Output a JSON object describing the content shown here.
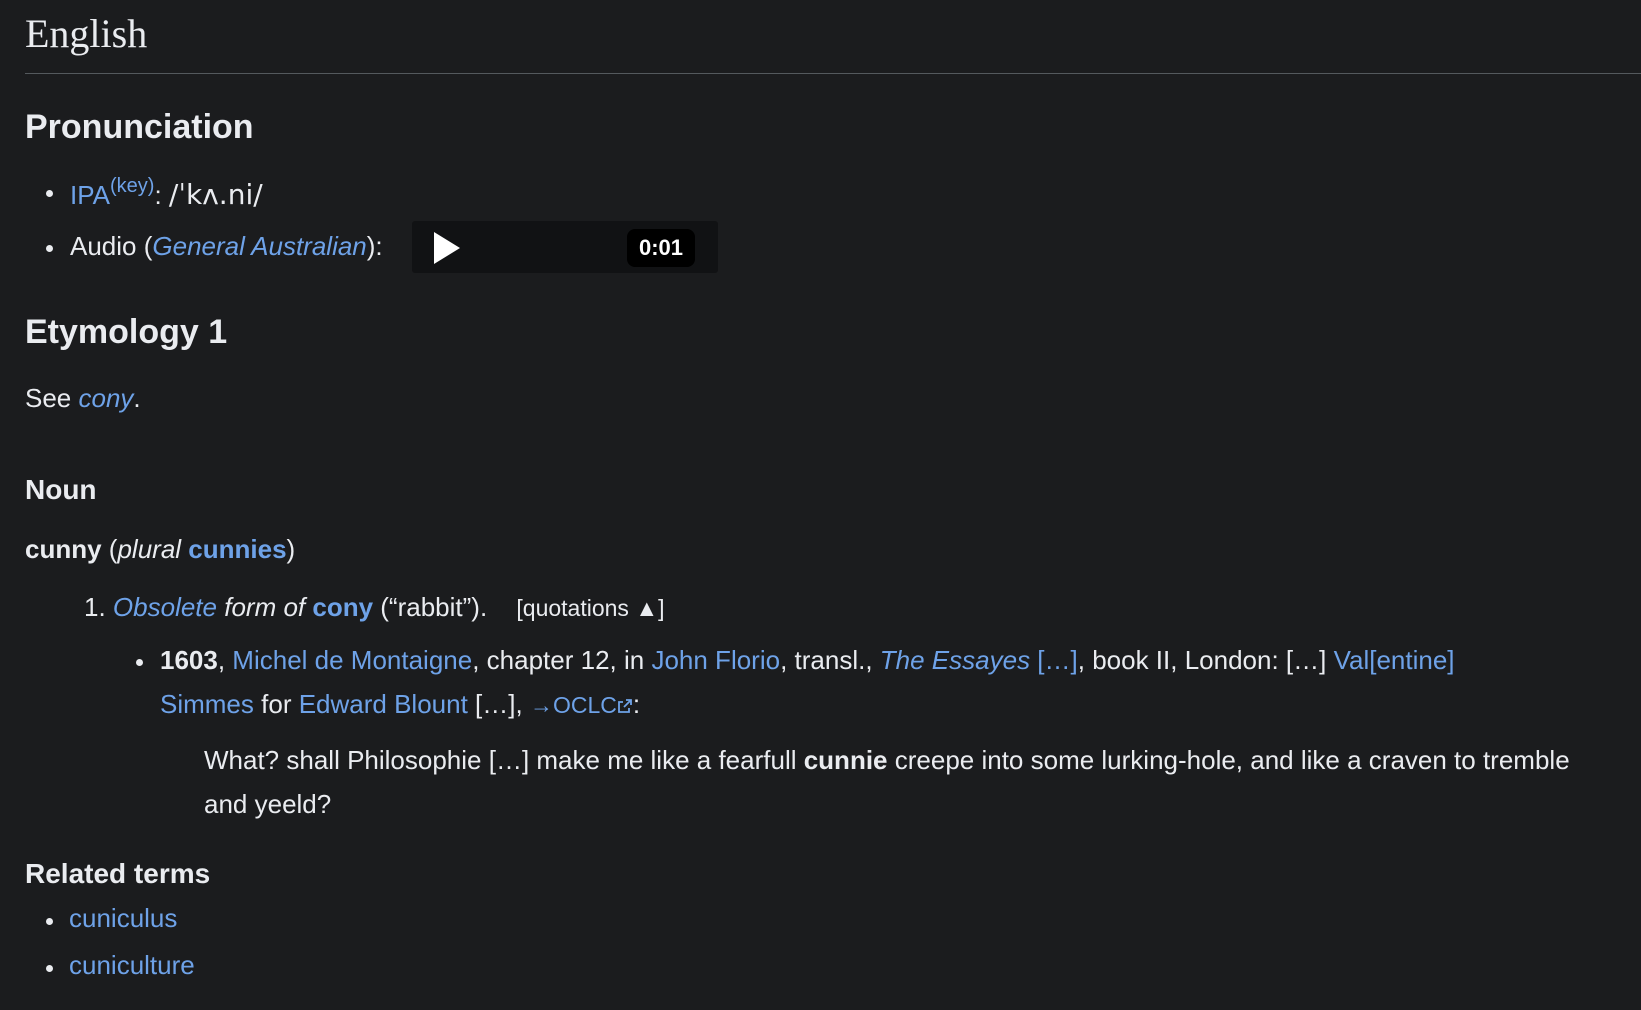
{
  "language": "English",
  "pronunciation": {
    "heading": "Pronunciation",
    "ipa": {
      "label": "IPA",
      "key": "(key)",
      "colon": ": ",
      "value": "/ˈkʌ.ni/"
    },
    "audio": {
      "label": "Audio (",
      "accent": "General Australian",
      "suffix": "):",
      "time": "0:01"
    }
  },
  "etymology": {
    "heading": "Etymology 1",
    "see": "See ",
    "see_link": "cony",
    "period": "."
  },
  "noun": {
    "heading": "Noun",
    "headword": "cunny",
    "open_paren": " (",
    "plural_label": "plural",
    "plural_space": " ",
    "plural_form": "cunnies",
    "close_paren": ")"
  },
  "sense": {
    "number": "1.",
    "obsolete": "Obsolete",
    "form_of": " form of ",
    "lemma": "cony",
    "gloss": " (“rabbit”).",
    "quotations_toggle": "[quotations ▲]"
  },
  "citation": {
    "year": "1603",
    "sep1": ", ",
    "author": "Michel de Montaigne",
    "chapter": ", chapter 12, in ",
    "translator": "John Florio",
    "transl": ", transl., ",
    "title": "The Essayes",
    "title_ellipsis": " […]",
    "book": ", book II, London: […] ",
    "printer_line1": "Val[entine]",
    "printer_line2": "Simmes",
    "for": " for ",
    "publisher": "Edward Blount",
    "ellipsis": " […], ",
    "oclc": "→OCLC",
    "colon": ":"
  },
  "quote": {
    "before": "What? shall Philosophie […] make me like a fearfull ",
    "bold": "cunnie",
    "after": " creepe into some lurking-hole, and like a craven to tremble and yeeld?"
  },
  "related": {
    "heading": "Related terms",
    "items": [
      "cuniculus",
      "cuniculture"
    ]
  }
}
